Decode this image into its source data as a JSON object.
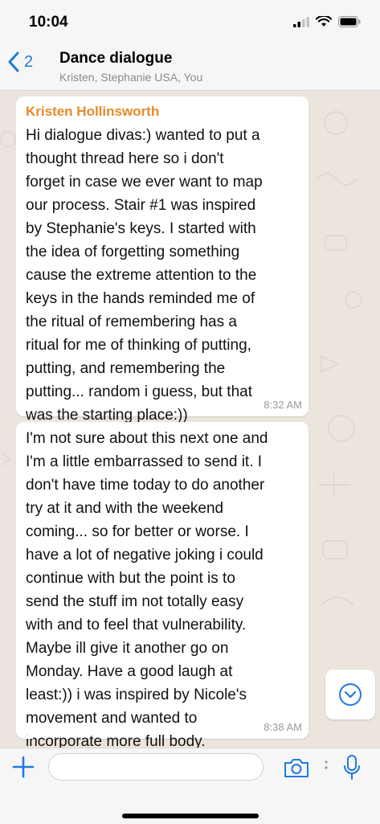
{
  "status": {
    "time": "10:04"
  },
  "header": {
    "back_count": "2",
    "title": "Dance dialogue",
    "subtitle": "Kristen, Stephanie USA, You"
  },
  "messages": [
    {
      "sender": "Kristen Hollinsworth",
      "text": "Hi dialogue divas:) wanted to put a\nthought thread here so i don't\nforget in case we ever want to map\nour process. Stair #1 was inspired\nby Stephanie's keys.  I started with\nthe idea of forgetting something\ncause the extreme attention to the\nkeys in the hands reminded me of\nthe ritual of remembering has a\nritual for me of thinking of putting,\nputting,  and remembering the\nputting... random i guess,  but that\nwas the starting place:))",
      "time": "8:32 AM"
    },
    {
      "sender": "",
      "text": "I'm not sure about this next one and\nI'm a little embarrassed to send it.  I\ndon't have time today to do another\ntry at it and with the weekend\ncoming... so for better or worse.  I\nhave a lot of negative joking i could\ncontinue with but the point is to\nsend the stuff im not totally easy\nwith and to feel that vulnerability.\nMaybe ill give it another go on\nMonday.  Have a good laugh at\nleast:)) i was inspired by Nicole's\nmovement and wanted to\nincorporate more full body.",
      "time": "8:38 AM"
    }
  ],
  "input": {
    "placeholder": "",
    "value": ""
  },
  "icons": {
    "back": "chevron-left-icon",
    "scroll_down": "chevron-down-circle-icon",
    "plus": "plus-icon",
    "camera": "camera-icon",
    "mic": "microphone-icon"
  },
  "colors": {
    "accent": "#1f7ae0",
    "sender": "#e78a29",
    "chat_bg": "#ece5dd"
  }
}
